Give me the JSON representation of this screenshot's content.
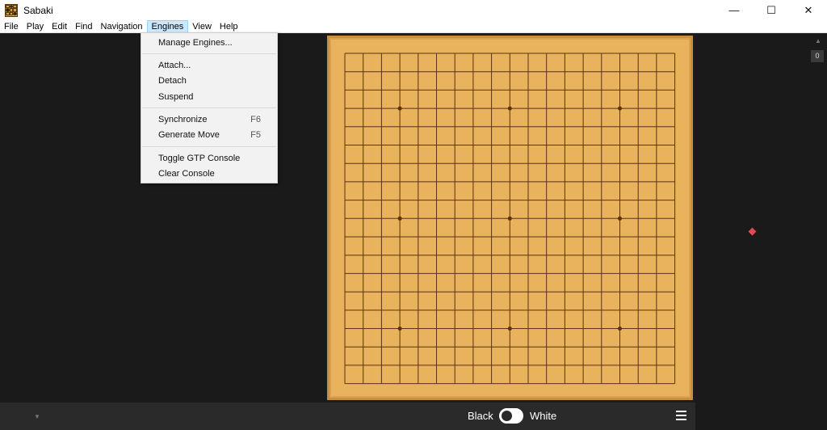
{
  "window": {
    "title": "Sabaki"
  },
  "window_controls": {
    "minimize": "—",
    "maximize": "☐",
    "close": "✕"
  },
  "menubar": [
    "File",
    "Play",
    "Edit",
    "Find",
    "Navigation",
    "Engines",
    "View",
    "Help"
  ],
  "engines_menu": {
    "items": [
      {
        "label": "Manage Engines...",
        "accel": ""
      },
      {
        "label": "Attach...",
        "accel": ""
      },
      {
        "label": "Detach",
        "accel": ""
      },
      {
        "label": "Suspend",
        "accel": ""
      },
      {
        "label": "Synchronize",
        "accel": "F6"
      },
      {
        "label": "Generate Move",
        "accel": "F5"
      },
      {
        "label": "Toggle GTP Console",
        "accel": ""
      },
      {
        "label": "Clear Console",
        "accel": ""
      }
    ]
  },
  "board": {
    "size": 19,
    "stars": [
      [
        3,
        3
      ],
      [
        9,
        3
      ],
      [
        15,
        3
      ],
      [
        3,
        9
      ],
      [
        9,
        9
      ],
      [
        15,
        9
      ],
      [
        3,
        15
      ],
      [
        9,
        15
      ],
      [
        15,
        15
      ]
    ]
  },
  "bottom_bar": {
    "black_label": "Black",
    "white_label": "White"
  },
  "game_tree": {
    "move_number": "0"
  },
  "colors": {
    "board": "#e9b25d",
    "grid": "#5a3310",
    "marker": "#e5484d"
  }
}
